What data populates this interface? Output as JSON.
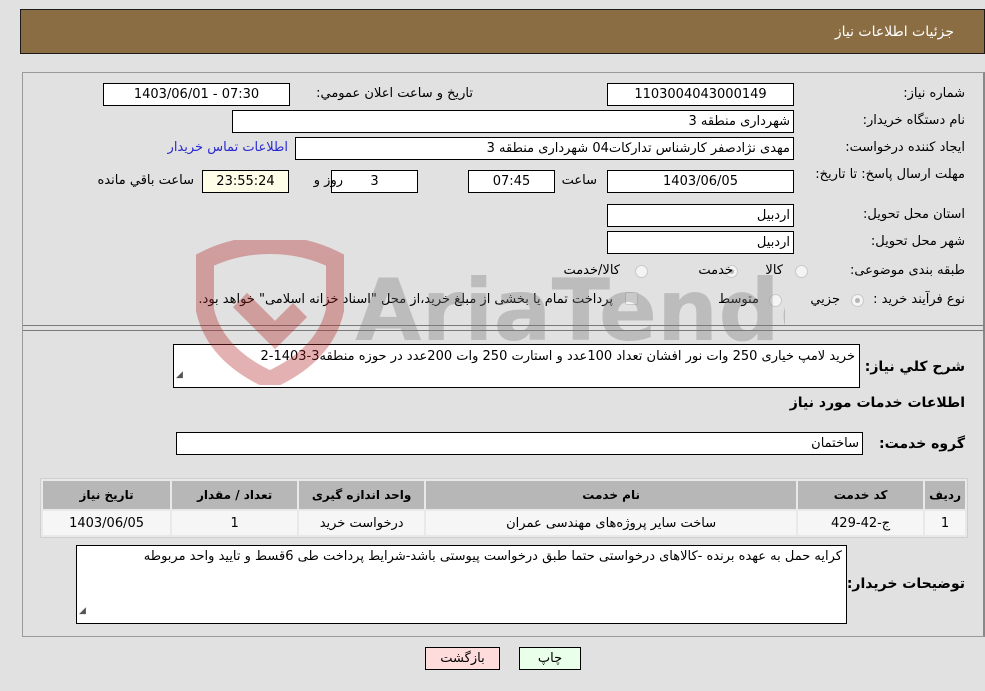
{
  "header": {
    "title": "جزئیات اطلاعات نیاز"
  },
  "fields": {
    "need_number": {
      "label": "شماره نیاز:",
      "value": "1103004043000149"
    },
    "announce_datetime": {
      "label": "تاریخ و ساعت اعلان عمومي:",
      "value": "1403/06/01 - 07:30"
    },
    "buyer_org": {
      "label": "نام دستگاه خريدار:",
      "value": "شهرداری منطقه 3"
    },
    "requester": {
      "label": "ایجاد کننده درخواست:",
      "value": "مهدی نژادصفر کارشناس تدارکات04 شهرداری منطقه 3"
    },
    "buyer_contact_link": "اطلاعات تماس خريدار",
    "deadline": {
      "label": "مهلت ارسال پاسخ: تا تاریخ:",
      "date": "1403/06/05",
      "time_label": "ساعت",
      "time": "07:45",
      "days": "3",
      "days_label": "روز و",
      "remaining": "23:55:24",
      "remaining_label": "ساعت باقي مانده"
    },
    "province": {
      "label": "استان محل تحویل:",
      "value": "اردبیل"
    },
    "city": {
      "label": "شهر محل تحویل:",
      "value": "اردبیل"
    },
    "category": {
      "label": "طبقه بندی موضوعی:",
      "options": [
        {
          "label": "کالا",
          "selected": false
        },
        {
          "label": "خدمت",
          "selected": true
        },
        {
          "label": "کالا/خدمت",
          "selected": false
        }
      ]
    },
    "purchase_type": {
      "label": "نوع فرآیند خرید :",
      "options": [
        {
          "label": "جزيي",
          "selected": true
        },
        {
          "label": "متوسط",
          "selected": false
        }
      ],
      "treasury_checkbox_label": "پرداخت تمام یا بخشی از مبلغ خرید،از محل \"اسناد خزانه اسلامی\" خواهد بود.",
      "treasury_checked": false
    }
  },
  "summary": {
    "label": "شرح کلي نياز:",
    "value": "خرید لامپ خیاری 250 وات نور افشان تعداد 100عدد و استارت 250 وات 200عدد در حوزه منطقه3-1403-2"
  },
  "services_section": {
    "title": "اطلاعات خدمات مورد نياز",
    "group_label": "گروه خدمت:",
    "group_value": "ساختمان"
  },
  "table": {
    "headers": [
      "رديف",
      "کد خدمت",
      "نام خدمت",
      "واحد اندازه گيری",
      "تعداد / مقدار",
      "تاريخ نياز"
    ],
    "rows": [
      [
        "1",
        "ج-42-429",
        "ساخت سایر پروژه‌های مهندسی عمران",
        "درخواست خريد",
        "1",
        "1403/06/05"
      ]
    ]
  },
  "buyer_notes": {
    "label": "توضيحات خريدار:",
    "value": "کرایه حمل به عهده برنده -کالاهای درخواستی حتما طبق درخواست پیوستی باشد-شرایط پرداخت طی 6قسط و تایید واحد مربوطه"
  },
  "buttons": {
    "print": "چاپ",
    "back": "بازگشت"
  },
  "watermark": {
    "text": "AriaTender.neT"
  },
  "colors": {
    "header_bg": "#8b6d43",
    "page_bg": "#e1e1e1",
    "link": "#2a2ad0",
    "print_btn": "#eaffea",
    "back_btn": "#ffdcdc",
    "remaining_bg": "#fefee8"
  }
}
